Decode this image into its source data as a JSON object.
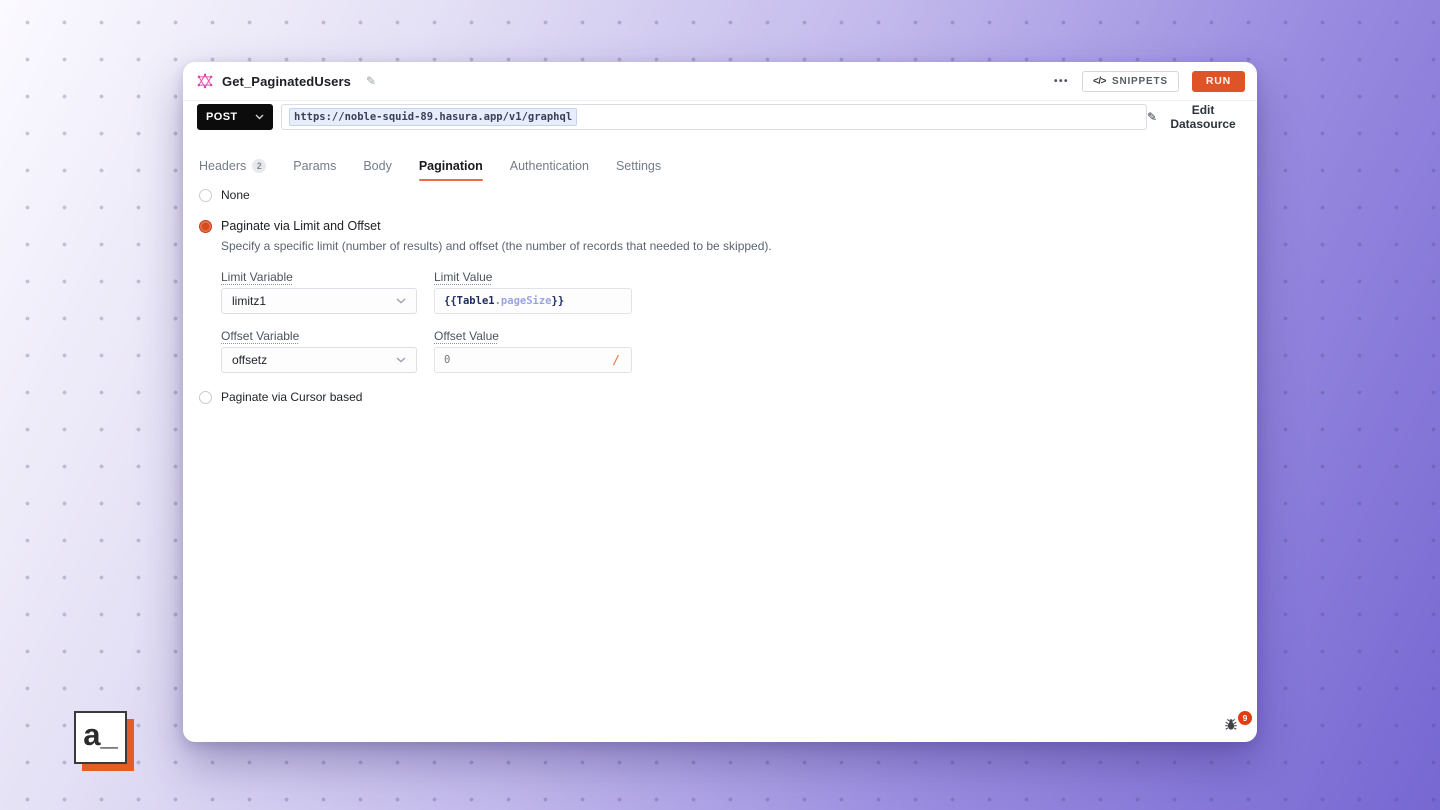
{
  "app": {
    "logo_text": "a_",
    "debug_badge": "9"
  },
  "icons": {
    "more": "•••",
    "code": "</>",
    "pencil": "✎",
    "slash": "/"
  },
  "header": {
    "title": "Get_PaginatedUsers",
    "snippets_label": "SNIPPETS",
    "run_label": "RUN"
  },
  "request": {
    "method": "POST",
    "url": "https://noble-squid-89.hasura.app/v1/graphql",
    "edit_datasource_label": "Edit Datasource"
  },
  "tabs": [
    {
      "label": "Headers",
      "badge": "2",
      "active": false
    },
    {
      "label": "Params",
      "active": false
    },
    {
      "label": "Body",
      "active": false
    },
    {
      "label": "Pagination",
      "active": true
    },
    {
      "label": "Authentication",
      "active": false
    },
    {
      "label": "Settings",
      "active": false
    }
  ],
  "pagination": {
    "options": [
      {
        "label": "None",
        "selected": false
      },
      {
        "label": "Paginate via Limit and Offset",
        "selected": true,
        "description": "Specify a specific limit (number of results) and offset (the number of records that needed to be skipped)."
      },
      {
        "label": "Paginate via Cursor based",
        "selected": false
      }
    ],
    "fields": {
      "limit_variable": {
        "label": "Limit Variable",
        "value": "limitz1"
      },
      "limit_value": {
        "label": "Limit Value",
        "parts": {
          "open": "{{",
          "object": "Table1",
          "dot": ".",
          "property": "pageSize",
          "close": "}}"
        }
      },
      "offset_variable": {
        "label": "Offset Variable",
        "value": "offsetz"
      },
      "offset_value": {
        "label": "Offset Value",
        "value": "0"
      }
    }
  },
  "colors": {
    "accent_orange": "#df5426",
    "tab_underline": "#ed6e42",
    "radio_selected": "#d94b1e",
    "method_bg": "#0c0c0c",
    "binding_highlight": "#e8edfb",
    "badge_red": "#e53a12",
    "bg_purple": "#7667d2"
  }
}
